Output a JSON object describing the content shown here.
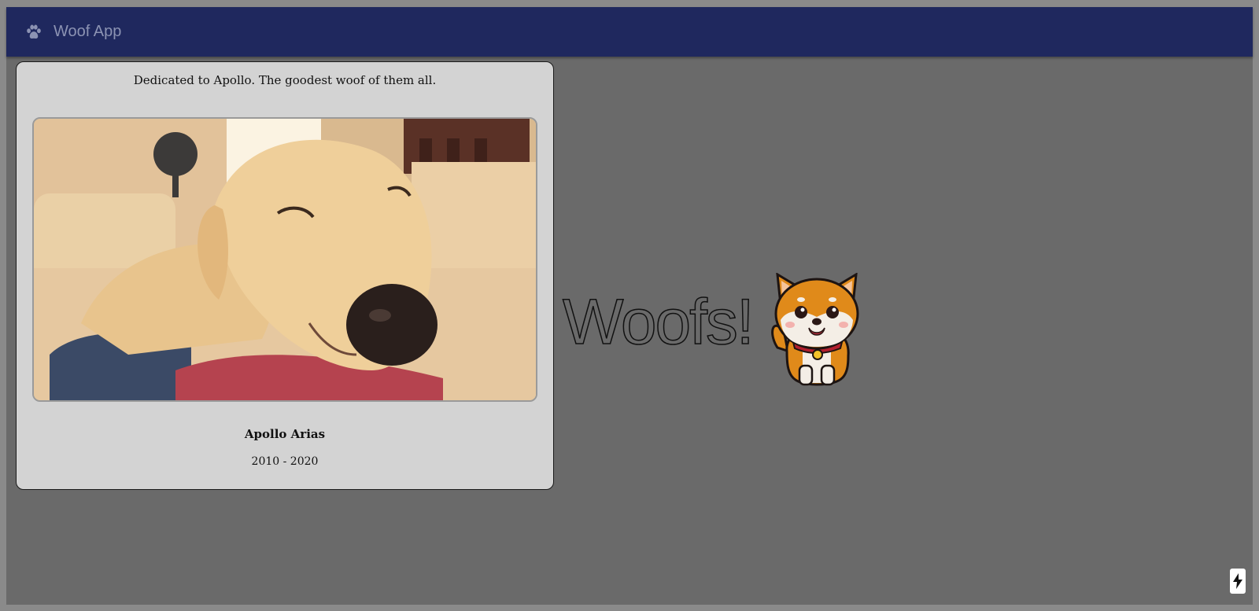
{
  "header": {
    "app_title": "Woof App",
    "icon": "paw-icon",
    "background": "#1f285e"
  },
  "memorial": {
    "dedication": "Dedicated to Apollo. The goodest woof of them all.",
    "photo_icon": "dog-photo",
    "name": "Apollo Arias",
    "years": "2010 - 2020"
  },
  "hero": {
    "headline": "Woofs!",
    "mascot_icon": "shiba-dog-icon"
  },
  "floating_action": {
    "icon": "lightning-bolt-icon"
  }
}
